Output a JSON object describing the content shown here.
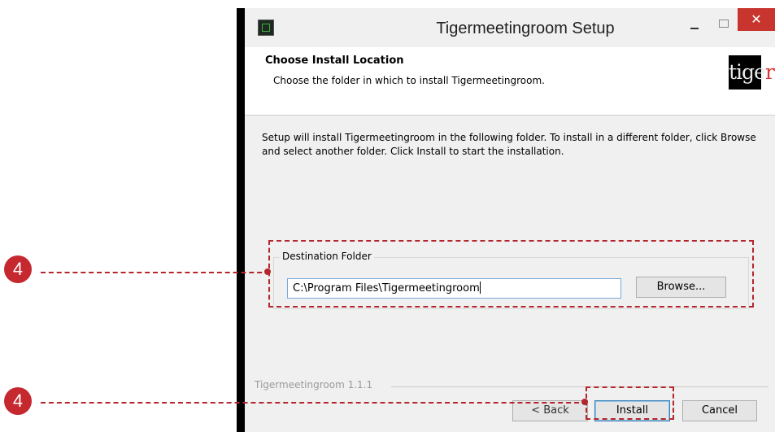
{
  "window": {
    "title": "Tigermeetingroom Setup",
    "close_glyph": "✕"
  },
  "header": {
    "title": "Choose Install Location",
    "subtitle": "Choose the folder in which to install Tigermeetingroom.",
    "logo_text": "tige",
    "logo_dot": "r"
  },
  "content": {
    "description": "Setup will install Tigermeetingroom in the following folder. To install in a different folder, click Browse and select another folder. Click Install to start the installation.",
    "destination_group_label": "Destination Folder",
    "destination_path": "C:\\Program Files\\Tigermeetingroom",
    "browse_label": "Browse..."
  },
  "footer": {
    "brand": "Tigermeetingroom 1.1.1",
    "back_label": "< Back",
    "install_label": "Install",
    "cancel_label": "Cancel"
  },
  "callouts": [
    {
      "number": "4"
    },
    {
      "number": "4"
    }
  ],
  "colors": {
    "callout": "#b3262c",
    "close_button": "#c8352e",
    "input_border": "#7aa7d9"
  }
}
